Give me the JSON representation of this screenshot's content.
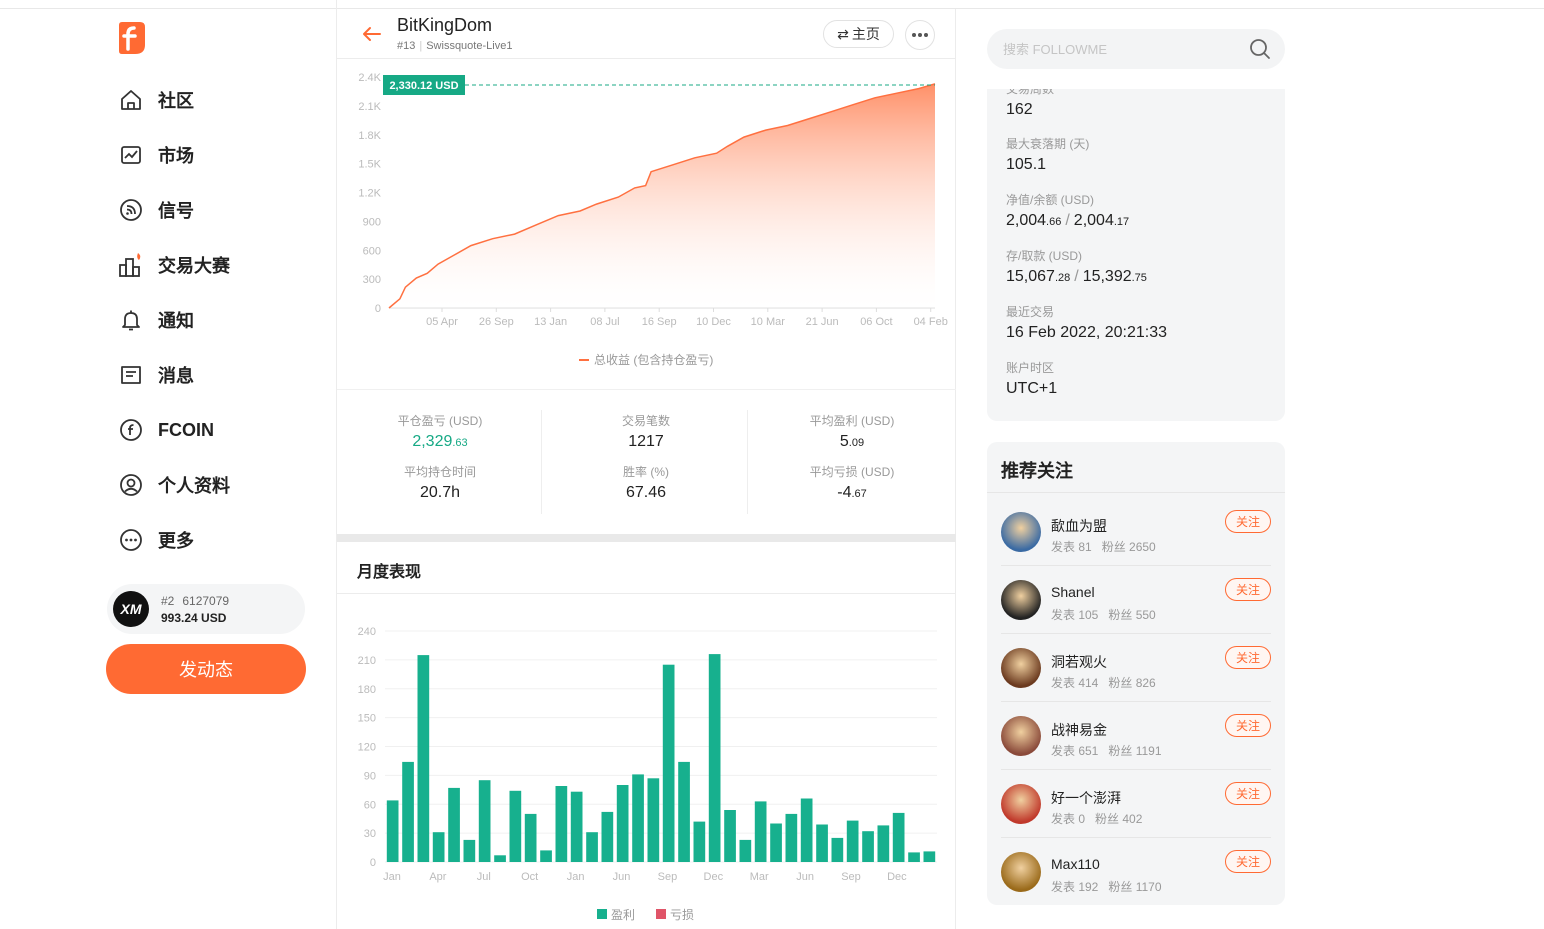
{
  "nav": {
    "items": [
      {
        "label": "社区",
        "icon": "home-icon"
      },
      {
        "label": "市场",
        "icon": "chart-icon"
      },
      {
        "label": "信号",
        "icon": "signal-icon"
      },
      {
        "label": "交易大赛",
        "icon": "competition-icon"
      },
      {
        "label": "通知",
        "icon": "bell-icon"
      },
      {
        "label": "消息",
        "icon": "message-icon"
      },
      {
        "label": "FCOIN",
        "icon": "fcoin-icon"
      },
      {
        "label": "个人资料",
        "icon": "profile-icon"
      },
      {
        "label": "更多",
        "icon": "more-icon"
      }
    ],
    "account": {
      "rank": "#2",
      "id": "6127079",
      "balance": "993.24 USD",
      "logo_text": "XM"
    },
    "post_button": "发动态"
  },
  "header": {
    "name": "BitKingDom",
    "rank": "#13",
    "server": "Swissquote-Live1",
    "home_button": "主页"
  },
  "equity_chart": {
    "tooltip": "2,330.12 USD",
    "yticks": [
      "2.4K",
      "2.1K",
      "1.8K",
      "1.5K",
      "1.2K",
      "900",
      "600",
      "300",
      "0"
    ],
    "xticks": [
      "05 Apr",
      "26 Sep",
      "13 Jan",
      "08 Jul",
      "16 Sep",
      "10 Dec",
      "10 Mar",
      "21 Jun",
      "06 Oct",
      "04 Feb"
    ],
    "legend": "总收益 (包含持仓盈亏)"
  },
  "stats": {
    "closed_pl": {
      "label": "平仓盈亏 (USD)",
      "int": "2,329",
      "dec": ".63"
    },
    "trades": {
      "label": "交易笔数",
      "value": "1217"
    },
    "avg_profit": {
      "label": "平均盈利 (USD)",
      "int": "5",
      "dec": ".09"
    },
    "avg_hold": {
      "label": "平均持仓时间",
      "value": "20.7h"
    },
    "win_rate": {
      "label": "胜率 (%)",
      "value": "67.46"
    },
    "avg_loss": {
      "label": "平均亏损 (USD)",
      "int": "-4",
      "dec": ".67"
    }
  },
  "monthly": {
    "title": "月度表现",
    "legend_profit": "盈利",
    "legend_loss": "亏损"
  },
  "chart_data": {
    "type": "bar",
    "title": "月度表现",
    "ylim": [
      0,
      240
    ],
    "yticks": [
      "240",
      "210",
      "180",
      "150",
      "120",
      "90",
      "60",
      "30",
      "0"
    ],
    "xticks": [
      "Jan",
      "Apr",
      "Jul",
      "Oct",
      "Jan",
      "Jun",
      "Sep",
      "Dec",
      "Mar",
      "Jun",
      "Sep",
      "Dec"
    ],
    "series": [
      {
        "name": "盈利",
        "color": "#17b08e",
        "values": [
          64,
          104,
          215,
          31,
          77,
          23,
          85,
          7,
          74,
          50,
          12,
          79,
          73,
          31,
          52,
          80,
          91,
          87,
          205,
          104,
          42,
          216,
          54,
          23,
          63,
          40,
          50,
          66,
          39,
          25,
          43,
          32,
          38,
          51,
          10,
          11
        ]
      }
    ],
    "legend": [
      "盈利",
      "亏损"
    ],
    "grid": true
  },
  "search": {
    "placeholder": "搜索 FOLLOWME"
  },
  "info": {
    "partial_label": "交易周数",
    "weeks": "162",
    "max_dd_label": "最大衰落期 (天)",
    "max_dd": "105.1",
    "equity_label": "净值/余额 (USD)",
    "equity_int": "2,004",
    "equity_dec": ".66",
    "balance_int": "2,004",
    "balance_dec": ".17",
    "deposit_label": "存/取款 (USD)",
    "deposit_int": "15,067",
    "deposit_dec": ".28",
    "withdraw_int": "15,392",
    "withdraw_dec": ".75",
    "last_trade_label": "最近交易",
    "last_trade": "16 Feb 2022, 20:21:33",
    "tz_label": "账户时区",
    "tz": "UTC+1"
  },
  "recommend": {
    "title": "推荐关注",
    "follow_label": "关注",
    "posts_label": "发表",
    "fans_label": "粉丝",
    "users": [
      {
        "name": "歃血为盟",
        "posts": "81",
        "fans": "2650",
        "color": "#3a6aa3"
      },
      {
        "name": "Shanel",
        "posts": "105",
        "fans": "550",
        "color": "#222222"
      },
      {
        "name": "洞若观火",
        "posts": "414",
        "fans": "826",
        "color": "#6b3a1f"
      },
      {
        "name": "战神易金",
        "posts": "651",
        "fans": "1191",
        "color": "#8a4a3a"
      },
      {
        "name": "好一个澎湃",
        "posts": "0",
        "fans": "402",
        "color": "#c0392b"
      },
      {
        "name": "Max110",
        "posts": "192",
        "fans": "1170",
        "color": "#9a6a1a"
      }
    ]
  }
}
